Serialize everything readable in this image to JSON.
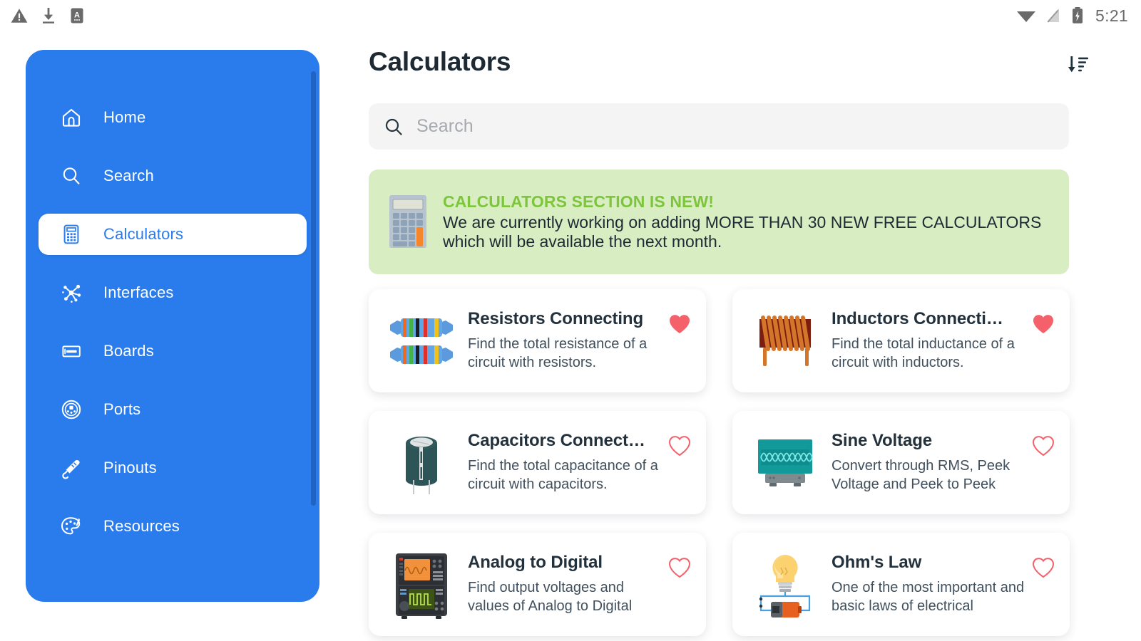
{
  "statusbar": {
    "time": "5:21",
    "left_icons": [
      "warning-triangle-icon",
      "download-icon",
      "app-a-icon"
    ],
    "right_icons": [
      "wifi-icon",
      "signal-off-icon",
      "battery-charging-icon"
    ]
  },
  "sidebar": {
    "background_color": "#2a7ced",
    "items": [
      {
        "label": "Home",
        "icon": "home-icon",
        "active": false
      },
      {
        "label": "Search",
        "icon": "search-icon",
        "active": false
      },
      {
        "label": "Calculators",
        "icon": "calculator-icon",
        "active": true
      },
      {
        "label": "Interfaces",
        "icon": "nodes-icon",
        "active": false
      },
      {
        "label": "Boards",
        "icon": "board-icon",
        "active": false
      },
      {
        "label": "Ports",
        "icon": "port-icon",
        "active": false
      },
      {
        "label": "Pinouts",
        "icon": "jack-plug-icon",
        "active": false
      },
      {
        "label": "Resources",
        "icon": "palette-icon",
        "active": false
      }
    ]
  },
  "header": {
    "title": "Calculators",
    "sort_icon": "sort-descending-icon"
  },
  "search": {
    "placeholder": "Search",
    "value": "",
    "icon": "search-icon"
  },
  "banner": {
    "icon": "calculator-icon",
    "heading": "CALCULATORS SECTION IS NEW!",
    "body": "We are currently working on adding MORE THAN 30 NEW FREE CALCULATORS which will be available the next month.",
    "background_color": "#d9edc2",
    "heading_color": "#7dc63c"
  },
  "colors": {
    "accent_blue": "#2a7ced",
    "heart_red": "#f4616b",
    "title_dark": "#23313c"
  },
  "cards": [
    {
      "title": "Resistors Connecting",
      "description": "Find the total resistance of a circuit with resistors.",
      "icon": "resistor-icon",
      "favorite": true
    },
    {
      "title": "Inductors Connecti…",
      "description": "Find the total inductance of a circuit with inductors.",
      "icon": "inductor-coil-icon",
      "favorite": true
    },
    {
      "title": "Capacitors Connect…",
      "description": "Find the total capacitance of a circuit with capacitors.",
      "icon": "capacitor-icon",
      "favorite": false
    },
    {
      "title": "Sine Voltage",
      "description": "Convert through RMS, Peek Voltage and Peek to Peek Voltage used in s…",
      "icon": "oscilloscope-sine-icon",
      "favorite": false
    },
    {
      "title": "Analog to Digital",
      "description": "Find output voltages and values of Analog to Digital Converters.",
      "icon": "adc-instrument-icon",
      "favorite": false
    },
    {
      "title": "Ohm's Law",
      "description": "One of the most important and basic laws of electrical circuits.",
      "icon": "bulb-battery-circuit-icon",
      "favorite": false
    }
  ]
}
